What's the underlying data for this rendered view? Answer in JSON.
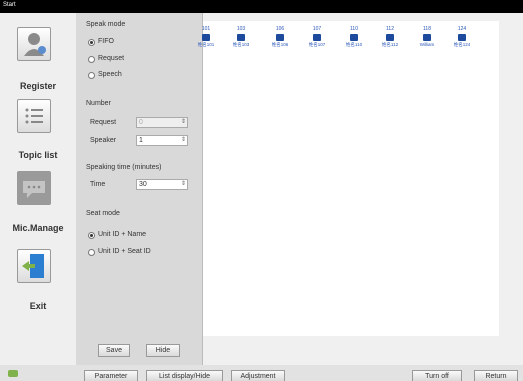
{
  "window": {
    "title": "Start"
  },
  "sidebar": {
    "items": [
      {
        "label": "Register",
        "icon": "user-register-icon"
      },
      {
        "label": "Topic list",
        "icon": "list-icon"
      },
      {
        "label": "Mic.Manage",
        "icon": "chat-bubble-icon"
      },
      {
        "label": "Exit",
        "icon": "exit-door-icon"
      }
    ]
  },
  "panel": {
    "speak_mode_title": "Speak mode",
    "speak_modes": [
      {
        "label": "FIFO",
        "selected": true
      },
      {
        "label": "Requset",
        "selected": false
      },
      {
        "label": "Speech",
        "selected": false
      }
    ],
    "number_title": "Number",
    "request_label": "Request",
    "request_value": "0",
    "speaker_label": "Speaker",
    "speaker_value": "1",
    "speaking_time_title": "Speaking time (minutes)",
    "time_label": "Time",
    "time_value": "30",
    "seat_mode_title": "Seat mode",
    "seat_modes": [
      {
        "label": "Unit ID + Name",
        "selected": true
      },
      {
        "label": "Unit ID + Seat ID",
        "selected": false
      }
    ],
    "save_label": "Save",
    "hide_label": "Hide"
  },
  "units": [
    {
      "id": "101",
      "name": "姓名101"
    },
    {
      "id": "103",
      "name": "姓名103"
    },
    {
      "id": "106",
      "name": "姓名106"
    },
    {
      "id": "107",
      "name": "姓名107"
    },
    {
      "id": "110",
      "name": "姓名110"
    },
    {
      "id": "112",
      "name": "姓名112"
    },
    {
      "id": "118",
      "name": "William"
    },
    {
      "id": "124",
      "name": "姓名124"
    }
  ],
  "bottom": {
    "parameter": "Parameter",
    "list_display": "List display/Hide",
    "adjustment": "Adjustment",
    "turn_off": "Turn off",
    "return": "Return"
  }
}
